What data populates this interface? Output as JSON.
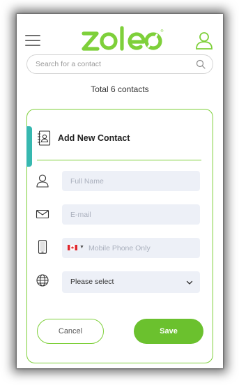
{
  "brand": {
    "logo_text": "zoleo",
    "green": "#7ed03a",
    "teal": "#37b8b0",
    "save_green": "#6bc12e"
  },
  "header": {
    "menu_icon": "hamburger-icon",
    "account_icon": "user-icon"
  },
  "search": {
    "placeholder": "Search for a contact",
    "icon": "search-icon"
  },
  "summary": {
    "total_text": "Total 6 contacts"
  },
  "form": {
    "title": "Add New Contact",
    "title_icon": "address-book-icon",
    "full_name_placeholder": "Full Name",
    "email_placeholder": "E-mail",
    "phone_placeholder": "Mobile Phone Only",
    "phone_country_flag": "canada-flag-icon",
    "region_value": "Please select",
    "cancel_label": "Cancel",
    "save_label": "Save"
  }
}
